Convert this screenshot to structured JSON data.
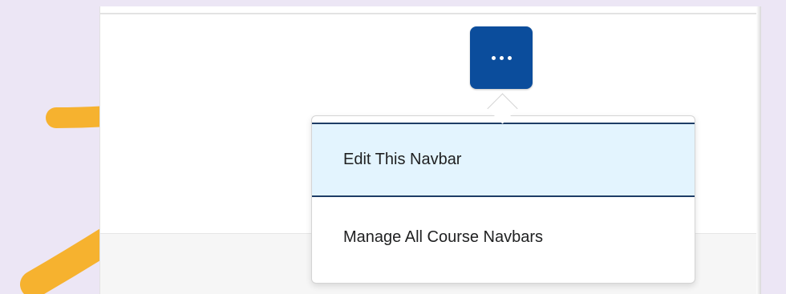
{
  "colors": {
    "background": "#ece6f5",
    "button": "#0b4d9c",
    "highlight": "#e3f4fe",
    "highlight_border": "#1e3d66",
    "arrow": "#f6b22f"
  },
  "navbar_options_button": {
    "icon": "more-dots-icon"
  },
  "menu": {
    "items": [
      {
        "label": "Edit This Navbar"
      },
      {
        "label": "Manage All Course Navbars"
      }
    ]
  },
  "annotations": {
    "arrow_icon": "arrow-right-icon"
  }
}
